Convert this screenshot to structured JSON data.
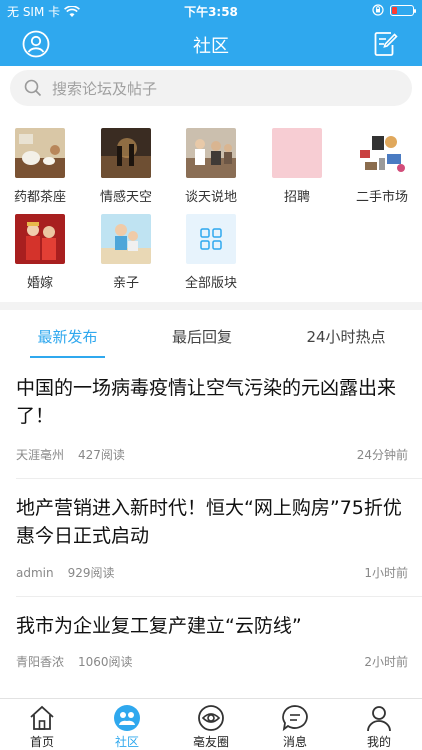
{
  "status_bar": {
    "carrier": "无 SIM 卡",
    "time": "下午3:58",
    "colors": {
      "bar": "#2fa8ee",
      "battery_low": "#ff3b30"
    }
  },
  "nav": {
    "title": "社区",
    "left_icon": "user-profile-icon",
    "right_icon": "compose-icon"
  },
  "search": {
    "placeholder": "搜索论坛及帖子",
    "icon": "search-icon"
  },
  "forums": [
    {
      "label": "药都茶座"
    },
    {
      "label": "情感天空"
    },
    {
      "label": "谈天说地"
    },
    {
      "label": "招聘"
    },
    {
      "label": "二手市场"
    },
    {
      "label": "婚嫁"
    },
    {
      "label": "亲子"
    },
    {
      "label": "全部版块"
    }
  ],
  "tabs": [
    {
      "label": "最新发布",
      "active": true
    },
    {
      "label": "最后回复",
      "active": false
    },
    {
      "label": "24小时热点",
      "active": false
    }
  ],
  "posts": [
    {
      "title": "中国的一场病毒疫情让空气污染的元凶露出来了！",
      "author": "天涯亳州",
      "reads": "427阅读",
      "time": "24分钟前"
    },
    {
      "title": "地产营销进入新时代！恒大“网上购房”75折优惠今日正式启动",
      "author": "admin",
      "reads": "929阅读",
      "time": "1小时前"
    },
    {
      "title": "我市为企业复工复产建立“云防线”",
      "author": "青阳香浓",
      "reads": "1060阅读",
      "time": "2小时前"
    }
  ],
  "tabbar": [
    {
      "label": "首页",
      "icon": "home-icon",
      "active": false
    },
    {
      "label": "社区",
      "icon": "community-icon",
      "active": true
    },
    {
      "label": "亳友圈",
      "icon": "friends-circle-icon",
      "active": false
    },
    {
      "label": "消息",
      "icon": "message-icon",
      "active": false
    },
    {
      "label": "我的",
      "icon": "profile-icon",
      "active": false
    }
  ],
  "accent_color": "#2fa8ee"
}
